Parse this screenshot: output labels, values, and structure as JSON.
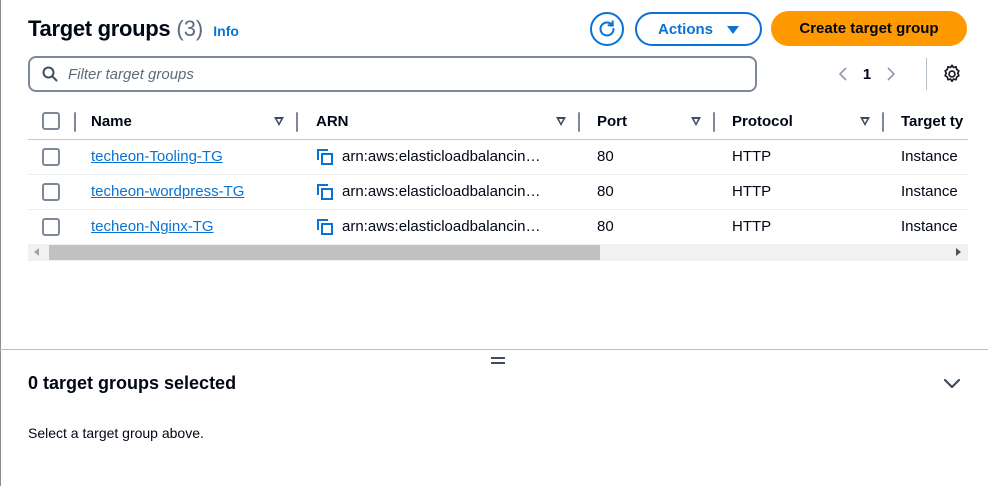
{
  "header": {
    "title": "Target groups",
    "count": "(3)",
    "info_label": "Info",
    "actions_label": "Actions",
    "create_label": "Create target group"
  },
  "filter": {
    "placeholder": "Filter target groups"
  },
  "pagination": {
    "current_page": "1"
  },
  "table": {
    "columns": [
      "Name",
      "ARN",
      "Port",
      "Protocol",
      "Target ty"
    ],
    "rows": [
      {
        "name": "techeon-Tooling-TG",
        "arn": "arn:aws:elasticloadbalancin…",
        "port": "80",
        "protocol": "HTTP",
        "target_type": "Instance"
      },
      {
        "name": "techeon-wordpress-TG",
        "arn": "arn:aws:elasticloadbalancin…",
        "port": "80",
        "protocol": "HTTP",
        "target_type": "Instance"
      },
      {
        "name": "techeon-Nginx-TG",
        "arn": "arn:aws:elasticloadbalancin…",
        "port": "80",
        "protocol": "HTTP",
        "target_type": "Instance"
      }
    ]
  },
  "split_panel": {
    "title": "0 target groups selected",
    "message": "Select a target group above."
  },
  "colors": {
    "link": "#0972d3",
    "primary_button": "#ff9900",
    "text": "#000716"
  },
  "icons": [
    "refresh-icon",
    "caret-down-icon",
    "search-icon",
    "chevron-left-icon",
    "chevron-right-icon",
    "settings-gear-icon",
    "sort-icon",
    "copy-icon",
    "drag-handle-icon",
    "chevron-down-icon"
  ]
}
